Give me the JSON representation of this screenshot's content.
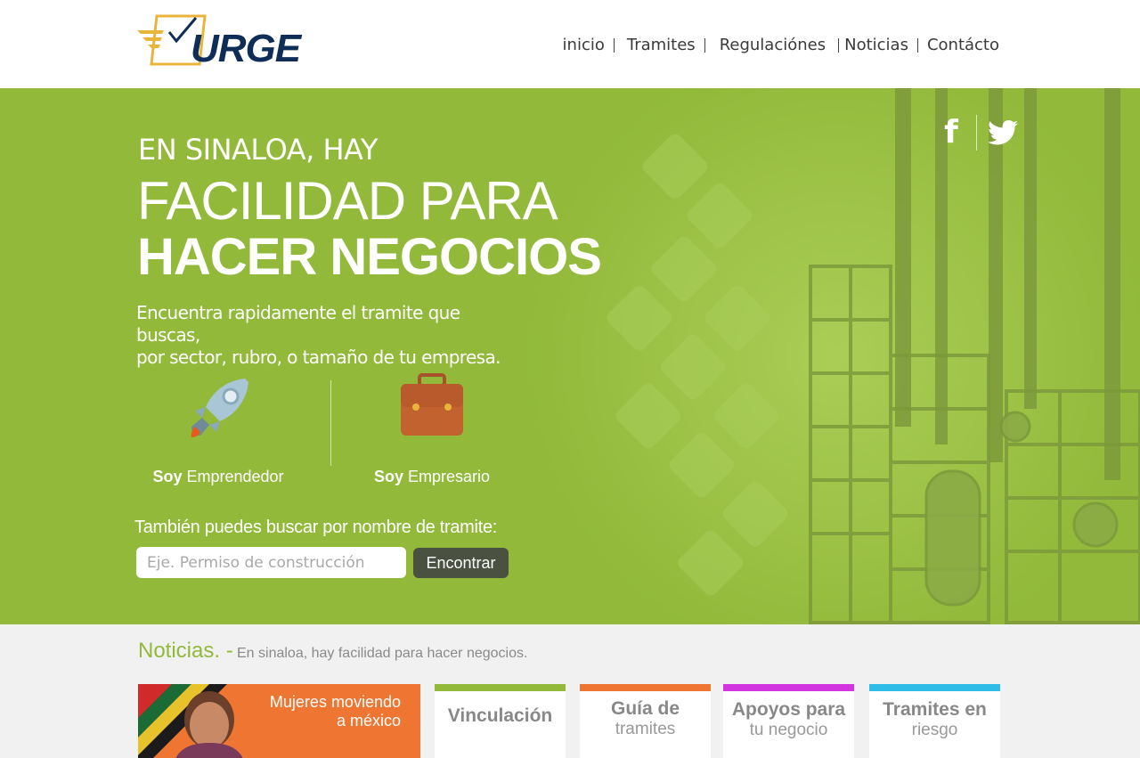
{
  "brand": {
    "logo_text": "URGE"
  },
  "nav": {
    "items": [
      "inicio",
      "Tramites",
      "Regulaciónes",
      "Noticias",
      "Contácto"
    ]
  },
  "social": {
    "facebook_icon": "facebook-icon",
    "twitter_icon": "twitter-icon"
  },
  "hero": {
    "pre": "EN SINALOA, HAY",
    "title_line1": "FACILIDAD PARA",
    "title_line2": "HACER NEGOCIOS",
    "subtitle_line1": "Encuentra rapidamente el tramite que buscas,",
    "subtitle_line2": "por sector, rubro, o tamaño de tu empresa.",
    "choices": [
      {
        "icon": "rocket-icon",
        "prefix": "Soy",
        "label": "Emprendedor"
      },
      {
        "icon": "briefcase-icon",
        "prefix": "Soy",
        "label": "Empresario"
      }
    ],
    "search_title": "También puedes buscar por nombre de tramite:",
    "search_placeholder": "Eje. Permiso de construcción",
    "search_button": "Encontrar"
  },
  "news": {
    "title": "Noticias. -",
    "subtitle": "En sinaloa, hay facilidad para hacer negocios.",
    "promo": {
      "line1": "Mujeres moviendo",
      "line2": "a méxico"
    },
    "cards": [
      {
        "line1": "Vinculación",
        "line2": "",
        "color": "#92b93a"
      },
      {
        "line1": "Guía de",
        "line2": "tramites",
        "color": "#ee7632"
      },
      {
        "line1": "Apoyos para",
        "line2": "tu negocio",
        "color": "#d234e0"
      },
      {
        "line1": "Tramites en",
        "line2": "riesgo",
        "color": "#2fbde8"
      }
    ]
  },
  "colors": {
    "hero_green": "#92b93a",
    "logo_navy": "#0f2e57",
    "logo_gold": "#e8b43a",
    "button_dark": "#4a5141"
  }
}
